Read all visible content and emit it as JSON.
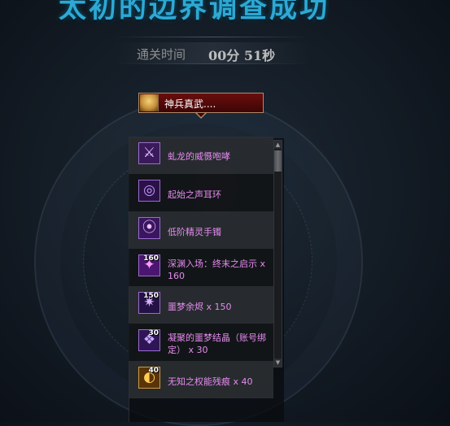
{
  "header": {
    "title": "太初的边界调查成功",
    "time_label": "通关时间",
    "time_value": "00分 51秒"
  },
  "character": {
    "name": "神兵真武....",
    "avatar_icon": "character-portrait-icon"
  },
  "rewards": [
    {
      "name": "虬龙的威慑咆哮",
      "qty": "",
      "count": "",
      "icon": "dragon-horn-icon",
      "glyph": "⚔",
      "color": "#7b3fb0"
    },
    {
      "name": "起始之声耳环",
      "qty": "",
      "count": "",
      "icon": "earring-icon",
      "glyph": "◎",
      "color": "#5a2a90"
    },
    {
      "name": "低阶精灵手镯",
      "qty": "",
      "count": "",
      "icon": "bracelet-icon",
      "glyph": "⦿",
      "color": "#6a2fa0"
    },
    {
      "name": "深渊入场：终末之启示",
      "qty": "x 160",
      "count": "160",
      "icon": "abyss-ticket-icon",
      "glyph": "✦",
      "color": "#8a2fc0"
    },
    {
      "name": "噩梦余烬",
      "qty": "x 150",
      "count": "150",
      "icon": "nightmare-ember-icon",
      "glyph": "✷",
      "color": "#4a2a80"
    },
    {
      "name": "凝聚的噩梦结晶（账号绑定）",
      "qty": "x 30",
      "count": "30",
      "icon": "nightmare-crystal-icon",
      "glyph": "❖",
      "color": "#5a3090"
    },
    {
      "name": "无知之权能残痕",
      "qty": "x 40",
      "count": "40",
      "icon": "power-remnant-icon",
      "glyph": "◐",
      "color": "#b0701a"
    }
  ],
  "scrollbar": {
    "up_icon": "scroll-up-arrow-icon",
    "down_icon": "scroll-down-arrow-icon"
  }
}
